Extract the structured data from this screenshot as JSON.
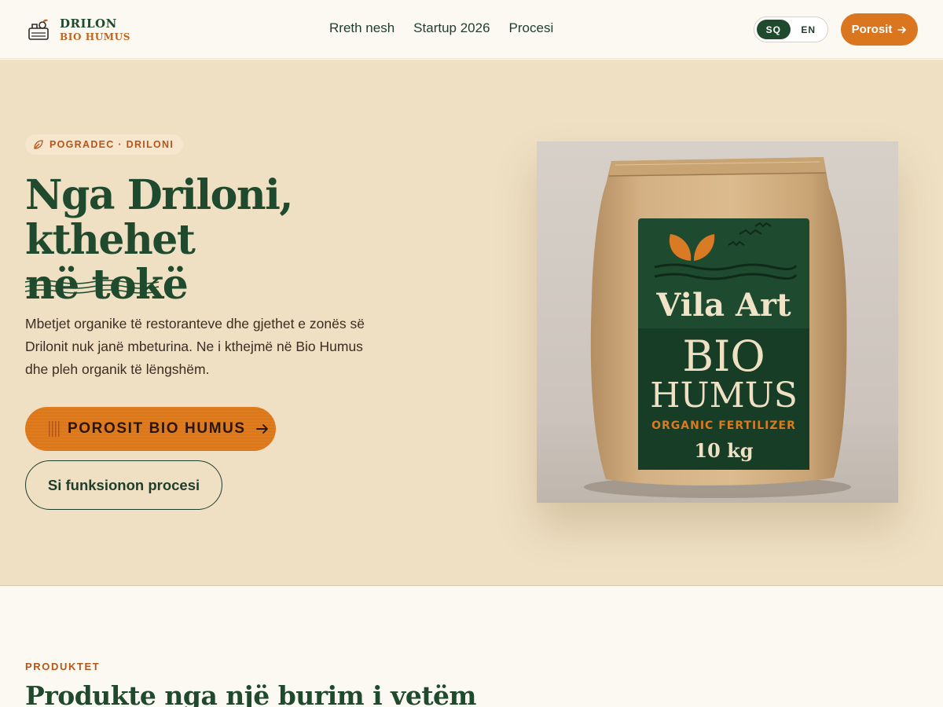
{
  "brand": {
    "line1": "DRILON",
    "line2": "BIO HUMUS"
  },
  "nav": {
    "items": [
      "Rreth nesh",
      "Startup 2026",
      "Procesi"
    ]
  },
  "lang": {
    "active": "SQ",
    "other": "EN"
  },
  "header": {
    "order_label": "Porosit"
  },
  "hero": {
    "badge": "POGRADEC · DRILONI",
    "title_line1": "Nga Driloni, kthehet",
    "title_line2": "në tokë",
    "description": "Mbetjet organike të restoranteve dhe gjethet e zonës së Drilonit nuk janë mbeturina. Ne i kthejmë në Bio Humus dhe pleh organik të lëngshëm.",
    "cta_primary": "POROSIT BIO HUMUS",
    "cta_secondary": "Si funksionon procesi"
  },
  "product_image": {
    "label_brand": "Vila Art",
    "label_line1": "BIO",
    "label_line2": "HUMUS",
    "label_sub": "ORGANIC FERTILIZER",
    "label_weight": "10 kg"
  },
  "products": {
    "eyebrow": "PRODUKTET",
    "title": "Produkte nga një burim i vetëm"
  },
  "colors": {
    "brand_green": "#1f4a2e",
    "accent_orange": "#d9761f",
    "hero_bg": "#efe0c3",
    "page_bg": "#fcf8f2"
  }
}
